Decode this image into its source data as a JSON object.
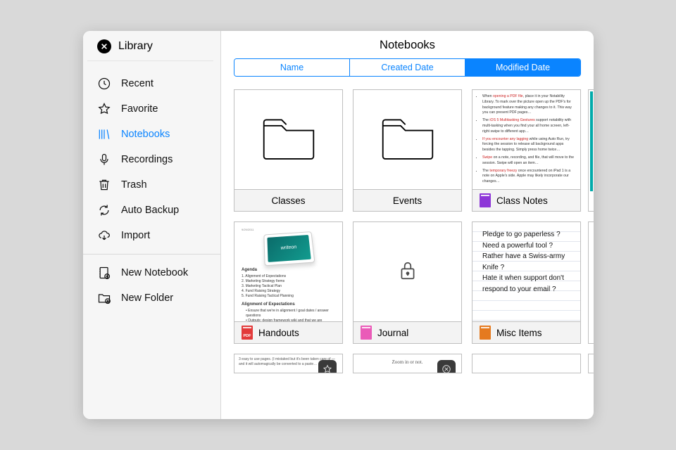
{
  "sidebar": {
    "title": "Library",
    "items": [
      {
        "label": "Recent",
        "icon": "clock-icon"
      },
      {
        "label": "Favorite",
        "icon": "star-icon"
      },
      {
        "label": "Notebooks",
        "icon": "books-icon",
        "selected": true
      },
      {
        "label": "Recordings",
        "icon": "mic-icon"
      },
      {
        "label": "Trash",
        "icon": "trash-icon"
      },
      {
        "label": "Auto Backup",
        "icon": "sync-icon"
      },
      {
        "label": "Import",
        "icon": "cloud-download-icon"
      }
    ],
    "actions": [
      {
        "label": "New Notebook",
        "icon": "new-notebook-icon"
      },
      {
        "label": "New Folder",
        "icon": "new-folder-icon"
      }
    ]
  },
  "main": {
    "title": "Notebooks",
    "segments": [
      {
        "label": "Name",
        "active": false
      },
      {
        "label": "Created Date",
        "active": false
      },
      {
        "label": "Modified Date",
        "active": true
      }
    ],
    "items": [
      {
        "label": "Classes",
        "type": "folder",
        "tag": null
      },
      {
        "label": "Events",
        "type": "folder",
        "tag": null
      },
      {
        "label": "Class Notes",
        "type": "notebook",
        "tag": "purple"
      },
      {
        "label": "Handouts",
        "type": "notebook",
        "tag": "pdf"
      },
      {
        "label": "Journal",
        "type": "notebook",
        "tag": "pink",
        "locked": true
      },
      {
        "label": "Misc Items",
        "type": "notebook",
        "tag": "orange"
      }
    ],
    "handouts_preview": {
      "agenda_title": "Agenda",
      "agenda_items": [
        "Alignment of Expectations",
        "Marketing Strategy Items",
        "Marketing Tactical Plan",
        "Fund Raising Strategy",
        "Fund Raising Tactical Planning"
      ],
      "section_title": "Alignment of Expectations"
    },
    "misc_preview": {
      "lines": [
        "Pledge to go paperless ?",
        "Need a powerful tool ?",
        "Rather have a Swiss-army",
        "Knife ?",
        "Hate it when support don't",
        "respond to your email ?"
      ]
    }
  }
}
